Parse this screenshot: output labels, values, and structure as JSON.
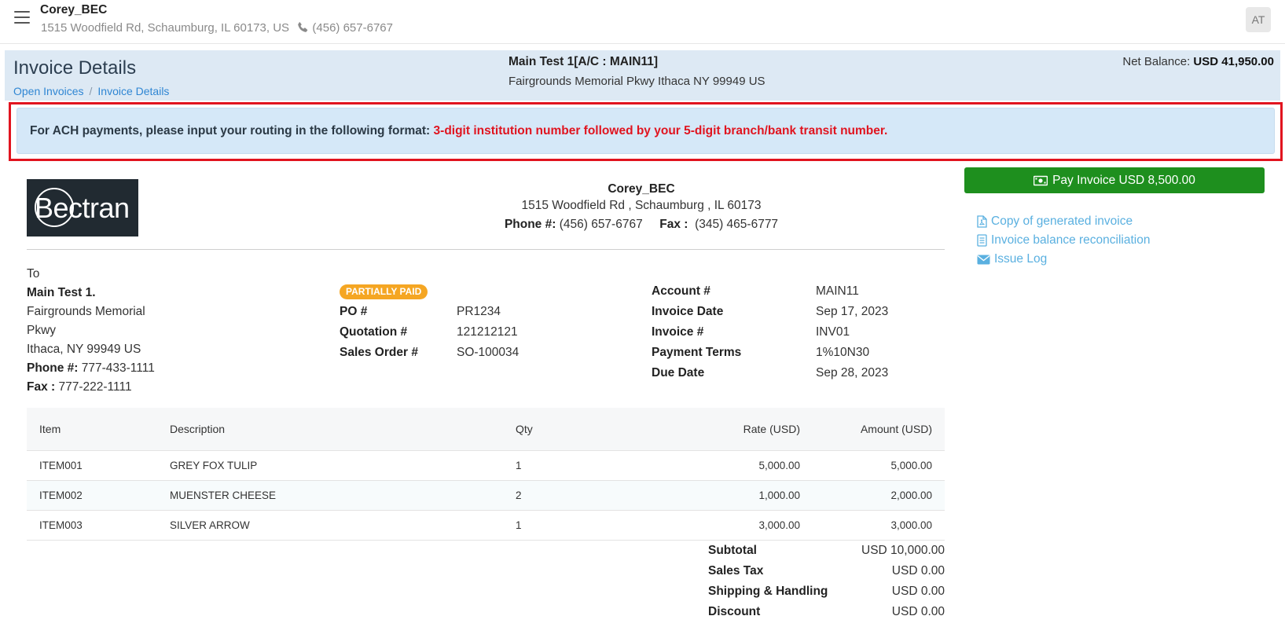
{
  "topbar": {
    "company_name": "Corey_BEC",
    "company_address": "1515 Woodfield Rd, Schaumburg, IL 60173, US",
    "company_phone": "(456) 657-6767",
    "avatar_initials": "AT"
  },
  "header": {
    "title": "Invoice Details",
    "breadcrumb": [
      {
        "label": "Open Invoices"
      },
      {
        "label": "Invoice Details"
      }
    ],
    "breadcrumb_separator": "/",
    "account_name": "Main Test 1[A/C : MAIN11]",
    "account_address": "Fairgrounds Memorial Pkwy  Ithaca  NY 99949 US",
    "net_balance_label": "Net Balance:",
    "net_balance_value": "USD 41,950.00"
  },
  "notice": {
    "prefix": "For ACH payments, please input your routing in the following format: ",
    "highlight": "3-digit institution number followed by your 5-digit branch/bank transit number.",
    "highlight_color": "#e0141f"
  },
  "logo": {
    "text": "Bectran"
  },
  "sender": {
    "name": "Corey_BEC",
    "address": "1515 Woodfield Rd ,  Schaumburg ,  IL  60173",
    "phone_label": "Phone #:",
    "phone": "(456) 657-6767",
    "fax_label": "Fax :",
    "fax": "(345) 465-6777"
  },
  "bill_to": {
    "label": "To",
    "name": "Main Test 1.",
    "address_line1": "Fairgrounds Memorial",
    "address_line2": "Pkwy",
    "address_line3": "Ithaca, NY 99949 US",
    "phone_label": "Phone #:",
    "phone": "777-433-1111",
    "fax_label": "Fax :",
    "fax": "777-222-1111"
  },
  "status_badge": {
    "label": "PARTIALLY PAID",
    "color": "#f5a623"
  },
  "order_info": [
    {
      "label": "PO #",
      "value": "PR1234"
    },
    {
      "label": "Quotation #",
      "value": "121212121"
    },
    {
      "label": "Sales Order #",
      "value": "SO-100034"
    }
  ],
  "invoice_info": [
    {
      "label": "Account #",
      "value": "MAIN11"
    },
    {
      "label": "Invoice Date",
      "value": "Sep 17, 2023"
    },
    {
      "label": "Invoice #",
      "value": "INV01"
    },
    {
      "label": "Payment Terms",
      "value": "1%10N30"
    },
    {
      "label": "Due Date",
      "value": "Sep 28, 2023"
    }
  ],
  "table": {
    "headers": [
      "Item",
      "Description",
      "Qty",
      "Rate (USD)",
      "Amount (USD)"
    ],
    "rows": [
      [
        "ITEM001",
        "GREY FOX TULIP",
        "1",
        "5,000.00",
        "5,000.00"
      ],
      [
        "ITEM002",
        "MUENSTER CHEESE",
        "2",
        "1,000.00",
        "2,000.00"
      ],
      [
        "ITEM003",
        "SILVER ARROW",
        "1",
        "3,000.00",
        "3,000.00"
      ]
    ]
  },
  "totals": [
    {
      "label": "Subtotal",
      "value": "USD 10,000.00"
    },
    {
      "label": "Sales Tax",
      "value": "USD 0.00"
    },
    {
      "label": "Shipping & Handling",
      "value": "USD 0.00"
    },
    {
      "label": "Discount",
      "value": "USD 0.00"
    }
  ],
  "actions": {
    "pay_button": "Pay Invoice USD 8,500.00",
    "pay_button_color": "#1e8f1e",
    "links": [
      {
        "label": "Copy of generated invoice",
        "icon": "pdf-file-icon"
      },
      {
        "label": "Invoice balance reconciliation",
        "icon": "document-icon"
      },
      {
        "label": "Issue Log",
        "icon": "envelope-icon"
      }
    ]
  }
}
